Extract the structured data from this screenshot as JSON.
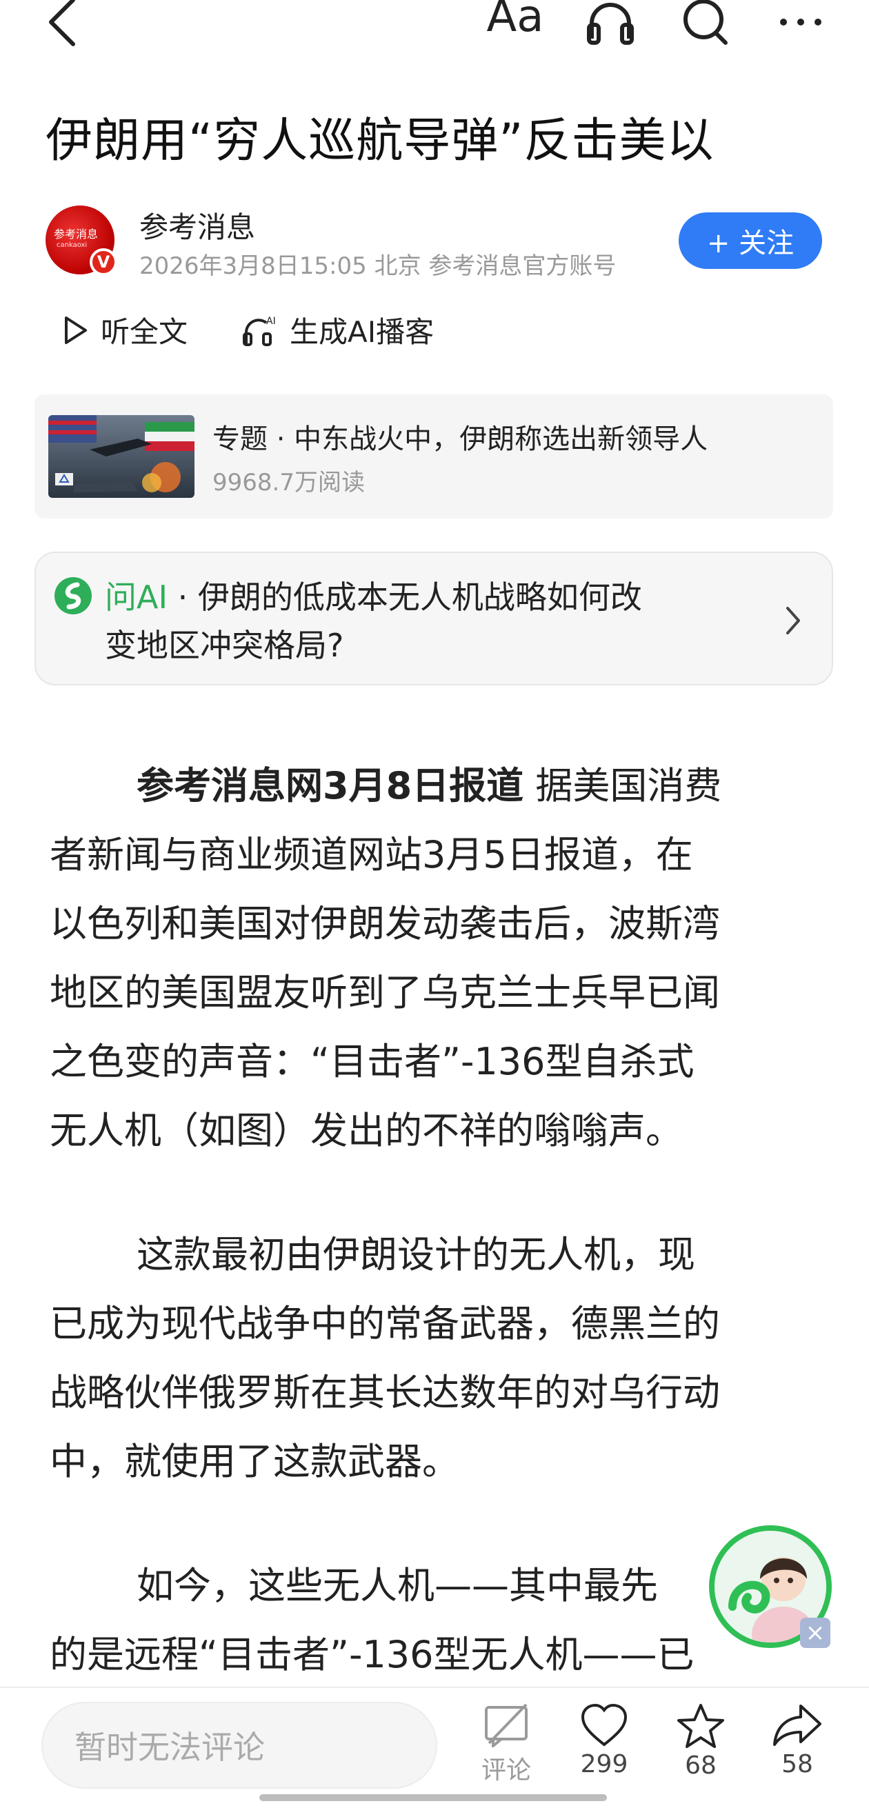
{
  "header": {
    "back_icon": "chevron-left-icon",
    "font_label": "Aa",
    "listen_icon": "headphones-icon",
    "search_icon": "search-icon",
    "more_icon": "more-icon"
  },
  "article": {
    "title": "伊朗用“穷人巡航导弹”反击美以",
    "author": {
      "name": "参考消息",
      "meta": "2026年3月8日15:05 北京 参考消息官方账号",
      "follow_label": "+ 关注",
      "badge": "V"
    },
    "actions": {
      "listen": "听全文",
      "podcast": "生成AI播客"
    },
    "topic": {
      "title": "专题 · 中东战火中，伊朗称选出新领导人",
      "reads": "9968.7万阅读"
    },
    "ask_ai": {
      "brand": "问AI",
      "line1": " · 伊朗的低成本无人机战略如何改",
      "line2": "变地区冲突格局?"
    },
    "paragraphs": [
      {
        "lead": "参考消息网3月8日报道",
        "lines": [
          " 据美国消费",
          "者新闻与商业频道网站3月5日报道，在",
          "以色列和美国对伊朗发动袭击后，波斯湾",
          "地区的美国盟友听到了乌克兰士兵早已闻",
          "之色变的声音：“目击者”-136型自杀式",
          "无人机（如图）发出的不祥的嗡嗡声。"
        ]
      },
      {
        "lines": [
          "这款最初由伊朗设计的无人机，现",
          "已成为现代战争中的常备武器，德黑兰的",
          "战略伙伴俄罗斯在其长达数年的对乌行动",
          "中，就使用了这款武器。"
        ]
      },
      {
        "lines": [
          "如今，这些无人机——其中最先",
          "的是远程“目击者”-136型无人机——已"
        ]
      }
    ]
  },
  "bottom_bar": {
    "comment_placeholder": "暂时无法评论",
    "comment_label": "评论",
    "likes": "299",
    "favorites": "68",
    "shares": "58"
  },
  "colors": {
    "accent": "#2f7cf6",
    "ai_green": "#2fae5a",
    "brand_red": "#e0261a"
  }
}
